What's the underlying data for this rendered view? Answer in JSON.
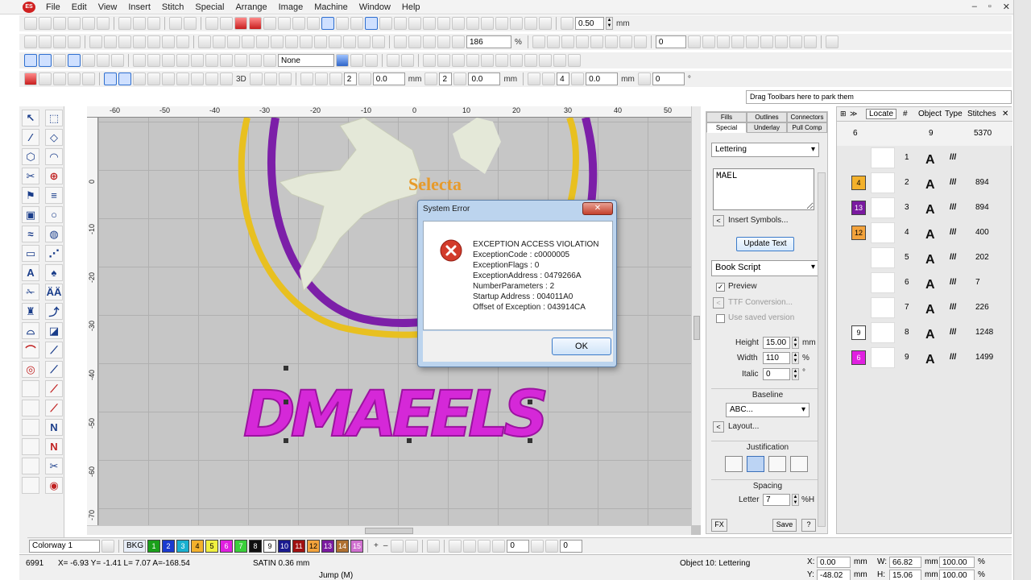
{
  "menu": [
    "File",
    "Edit",
    "View",
    "Insert",
    "Stitch",
    "Special",
    "Arrange",
    "Image",
    "Machine",
    "Window",
    "Help"
  ],
  "toolbar": {
    "stitch_spacing": "0.50",
    "spacing_unit": "mm",
    "zoom": "186",
    "zoom_unit": "%",
    "rotate_value": "0",
    "fill_none": "None",
    "field_a": "2",
    "field_b": "0.0",
    "field_c": "2",
    "field_d": "0.0",
    "field_e": "4",
    "field_f": "0.0",
    "field_g": "0",
    "unit_mm": "mm",
    "unit_deg": "°",
    "label_3d": "3D"
  },
  "drag_hint": "Drag Toolbars here to park them",
  "ruler_h": [
    "-60",
    "-50",
    "-40",
    "-30",
    "-20",
    "-10",
    "0",
    "10",
    "20",
    "30",
    "40",
    "50"
  ],
  "ruler_v": [
    "0",
    "-10",
    "-20",
    "-30",
    "-40",
    "-50",
    "-60",
    "-70"
  ],
  "canvas": {
    "lettering": "DMAEELS",
    "logo_text": "Selecta"
  },
  "dialog": {
    "title": "System Error",
    "close": "✕",
    "lines": [
      "EXCEPTION ACCESS VIOLATION",
      "ExceptionCode : c0000005",
      "ExceptionFlags : 0",
      "ExceptionAddress : 0479266A",
      "NumberParameters : 2",
      "Startup Address : 004011A0",
      "Offset of Exception : 043914CA"
    ],
    "ok": "OK"
  },
  "props": {
    "tabs_row1": [
      "Fills",
      "Outlines",
      "Connectors"
    ],
    "tabs_row2": [
      "Special",
      "Underlay",
      "Pull Comp"
    ],
    "object_type": "Lettering",
    "text": "MAEL",
    "insert_symbols": "Insert Symbols...",
    "update_text": "Update Text",
    "font": "Book Script",
    "preview": "Preview",
    "ttf_conversion": "TTF Conversion...",
    "use_saved": "Use saved version",
    "height_label": "Height",
    "height": "15.00",
    "height_unit": "mm",
    "width_label": "Width",
    "width": "110",
    "width_unit": "%",
    "italic_label": "Italic",
    "italic": "0",
    "italic_unit": "°",
    "baseline": "Baseline",
    "baseline_value": "ABC...",
    "layout": "Layout...",
    "justification": "Justification",
    "spacing": "Spacing",
    "letter_label": "Letter",
    "letter": "7",
    "letter_unit": "%H",
    "fx": "FX",
    "save": "Save",
    "help": "?"
  },
  "objlist": {
    "locate": "Locate",
    "cols": [
      "#",
      "Object",
      "Type",
      "Stitches"
    ],
    "summary": {
      "count": "6",
      "objects": "9",
      "stitches": "5370"
    },
    "rows": [
      {
        "color": "",
        "num": "1",
        "stitches": "",
        "swatch": "#ffffff"
      },
      {
        "color": "4",
        "num": "2",
        "stitches": "894",
        "swatch": "#f3b12c"
      },
      {
        "color": "13",
        "num": "3",
        "stitches": "894",
        "swatch": "#7a1aa0"
      },
      {
        "color": "12",
        "num": "4",
        "stitches": "400",
        "swatch": "#f3a33c"
      },
      {
        "color": "",
        "num": "5",
        "stitches": "202",
        "swatch": ""
      },
      {
        "color": "",
        "num": "6",
        "stitches": "7",
        "swatch": ""
      },
      {
        "color": "",
        "num": "7",
        "stitches": "226",
        "swatch": ""
      },
      {
        "color": "9",
        "num": "8",
        "stitches": "1248",
        "swatch": "#ffffff"
      },
      {
        "color": "6",
        "num": "9",
        "stitches": "1499",
        "swatch": "#e020e0"
      }
    ]
  },
  "colorbar": {
    "colorway": "Colorway 1",
    "bkg": "BKG",
    "chips": [
      {
        "n": "1",
        "c": "#1aa01a"
      },
      {
        "n": "2",
        "c": "#1a3ad0"
      },
      {
        "n": "3",
        "c": "#1ab0d0"
      },
      {
        "n": "4",
        "c": "#f3b12c"
      },
      {
        "n": "5",
        "c": "#f0f040"
      },
      {
        "n": "6",
        "c": "#e020e0"
      },
      {
        "n": "7",
        "c": "#3ad03a"
      },
      {
        "n": "8",
        "c": "#101010"
      },
      {
        "n": "9",
        "c": "#ffffff"
      },
      {
        "n": "10",
        "c": "#1a1a90"
      },
      {
        "n": "11",
        "c": "#a01010"
      },
      {
        "n": "12",
        "c": "#f3a33c"
      },
      {
        "n": "13",
        "c": "#7a1aa0"
      },
      {
        "n": "14",
        "c": "#b07030"
      },
      {
        "n": "15",
        "c": "#d070d0"
      }
    ],
    "angle1": "0",
    "angle2": "0"
  },
  "status": {
    "stitch_count": "6991",
    "coords": "X= -6.93 Y= -1.41 L= 7.07 A=-168.54",
    "stitch_type": "SATIN 0.36 mm",
    "jump": "Jump (M)",
    "object": "Object 10: Lettering",
    "x_label": "X:",
    "x": "0.00",
    "y_label": "Y:",
    "y": "-48.02",
    "w_label": "W:",
    "w": "66.82",
    "h_label": "H:",
    "h": "15.06",
    "unit": "mm",
    "pct1": "100.00",
    "pct2": "100.00",
    "pct_unit": "%"
  }
}
